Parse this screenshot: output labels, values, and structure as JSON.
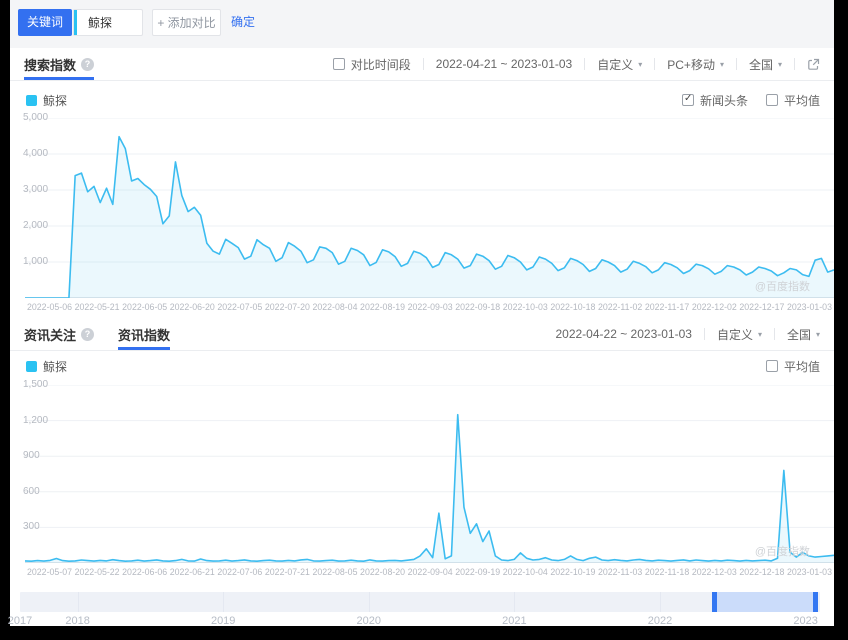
{
  "toolbar": {
    "keyword_label": "关键词",
    "keyword_value": "鲸探",
    "add_compare": "+ 添加对比",
    "confirm": "确定"
  },
  "search_section": {
    "title": "搜索指数",
    "legend_keyword": "鲸探",
    "controls": {
      "compare_period": "对比时间段",
      "compare_checked": false,
      "date_range": "2022-04-21 ~ 2023-01-03",
      "custom": "自定义",
      "device": "PC+移动",
      "region": "全国"
    },
    "right_legend": {
      "news": "新闻头条",
      "news_checked": true,
      "average": "平均值",
      "average_checked": false
    },
    "watermark": "@百度指数"
  },
  "news_section": {
    "title": "资讯关注",
    "tab": "资讯指数",
    "legend_keyword": "鲸探",
    "controls": {
      "date_range": "2022-04-22 ~ 2023-01-03",
      "custom": "自定义",
      "region": "全国"
    },
    "right_legend": {
      "average": "平均值",
      "average_checked": false
    },
    "watermark": "@百度指数"
  },
  "timeline": {
    "years": [
      "2017",
      "2018",
      "2019",
      "2020",
      "2021",
      "2022",
      "2023"
    ],
    "year_fracs": [
      0,
      0.072,
      0.254,
      0.436,
      0.618,
      0.8,
      0.982
    ],
    "selection_start_frac": 0.865,
    "selection_end_frac": 0.9975
  },
  "colors": {
    "accent_blue": "#3370f0",
    "line_cyan": "#3cbcf0",
    "legend_cyan": "#2ac2f2",
    "area_fill": "rgba(60,188,240,0.10)",
    "grid": "#eef1f4",
    "baseline": "#e3e6ea",
    "slider_selection": "#cbdcfa",
    "slider_handle": "#3377f2"
  },
  "chart_data": [
    {
      "type": "line",
      "title": "搜索指数",
      "series_name": "鲸探",
      "ylim": [
        0,
        5000
      ],
      "yticks": [
        {
          "value": 1000,
          "label": "1,000"
        },
        {
          "value": 2000,
          "label": "2,000"
        },
        {
          "value": 3000,
          "label": "3,000"
        },
        {
          "value": 4000,
          "label": "4,000"
        },
        {
          "value": 5000,
          "label": "5,000"
        }
      ],
      "x_labels": [
        "2022-05-06",
        "2022-05-21",
        "2022-06-05",
        "2022-06-20",
        "2022-07-05",
        "2022-07-20",
        "2022-08-04",
        "2022-08-19",
        "2022-09-03",
        "2022-09-18",
        "2022-10-03",
        "2022-10-18",
        "2022-11-02",
        "2022-11-17",
        "2022-12-02",
        "2022-12-17",
        "2023-01-03"
      ],
      "values": [
        0,
        0,
        0,
        0,
        0,
        0,
        0,
        0,
        3400,
        3470,
        2950,
        3100,
        2650,
        3050,
        2600,
        4480,
        4150,
        3250,
        3320,
        3150,
        3020,
        2820,
        2060,
        2280,
        3780,
        2850,
        2400,
        2520,
        2300,
        1520,
        1300,
        1220,
        1630,
        1520,
        1400,
        1080,
        1160,
        1620,
        1480,
        1380,
        1020,
        1120,
        1540,
        1440,
        1300,
        980,
        1060,
        1420,
        1380,
        1260,
        940,
        1020,
        1380,
        1320,
        1200,
        900,
        990,
        1340,
        1280,
        1150,
        880,
        960,
        1300,
        1240,
        1120,
        850,
        930,
        1260,
        1200,
        1080,
        830,
        900,
        1220,
        1160,
        1040,
        800,
        880,
        1180,
        1120,
        1000,
        780,
        860,
        1140,
        1080,
        960,
        760,
        840,
        1100,
        1040,
        930,
        740,
        820,
        1060,
        1000,
        900,
        720,
        800,
        1020,
        960,
        870,
        700,
        780,
        980,
        930,
        840,
        680,
        760,
        940,
        900,
        810,
        660,
        740,
        900,
        860,
        780,
        640,
        720,
        860,
        820,
        750,
        620,
        700,
        820,
        780,
        650,
        600,
        1050,
        1100,
        720,
        780
      ]
    },
    {
      "type": "line",
      "title": "资讯指数",
      "series_name": "鲸探",
      "ylim": [
        0,
        1500
      ],
      "yticks": [
        {
          "value": 300,
          "label": "300"
        },
        {
          "value": 600,
          "label": "600"
        },
        {
          "value": 900,
          "label": "900"
        },
        {
          "value": 1200,
          "label": "1,200"
        },
        {
          "value": 1500,
          "label": "1,500"
        }
      ],
      "x_labels": [
        "2022-05-07",
        "2022-05-22",
        "2022-06-06",
        "2022-06-21",
        "2022-07-06",
        "2022-07-21",
        "2022-08-05",
        "2022-08-20",
        "2022-09-04",
        "2022-09-19",
        "2022-10-04",
        "2022-10-19",
        "2022-11-03",
        "2022-11-18",
        "2022-12-03",
        "2022-12-18",
        "2023-01-03"
      ],
      "values": [
        18,
        15,
        20,
        16,
        22,
        38,
        20,
        15,
        18,
        25,
        20,
        16,
        22,
        18,
        28,
        20,
        15,
        18,
        24,
        16,
        20,
        26,
        18,
        15,
        20,
        30,
        18,
        16,
        34,
        20,
        16,
        18,
        24,
        16,
        20,
        26,
        18,
        15,
        20,
        24,
        18,
        16,
        22,
        18,
        26,
        30,
        18,
        16,
        20,
        24,
        16,
        18,
        24,
        18,
        15,
        26,
        18,
        16,
        20,
        22,
        18,
        24,
        30,
        60,
        120,
        45,
        420,
        35,
        60,
        1250,
        470,
        250,
        330,
        180,
        270,
        60,
        25,
        20,
        30,
        85,
        40,
        25,
        30,
        45,
        25,
        20,
        30,
        60,
        30,
        20,
        40,
        50,
        25,
        20,
        28,
        22,
        18,
        25,
        30,
        22,
        18,
        24,
        20,
        16,
        22,
        26,
        18,
        25,
        20,
        16,
        22,
        18,
        24,
        20,
        16,
        22,
        18,
        20,
        24,
        18,
        40,
        780,
        90,
        50,
        90,
        60,
        50,
        55,
        60,
        65
      ]
    }
  ]
}
